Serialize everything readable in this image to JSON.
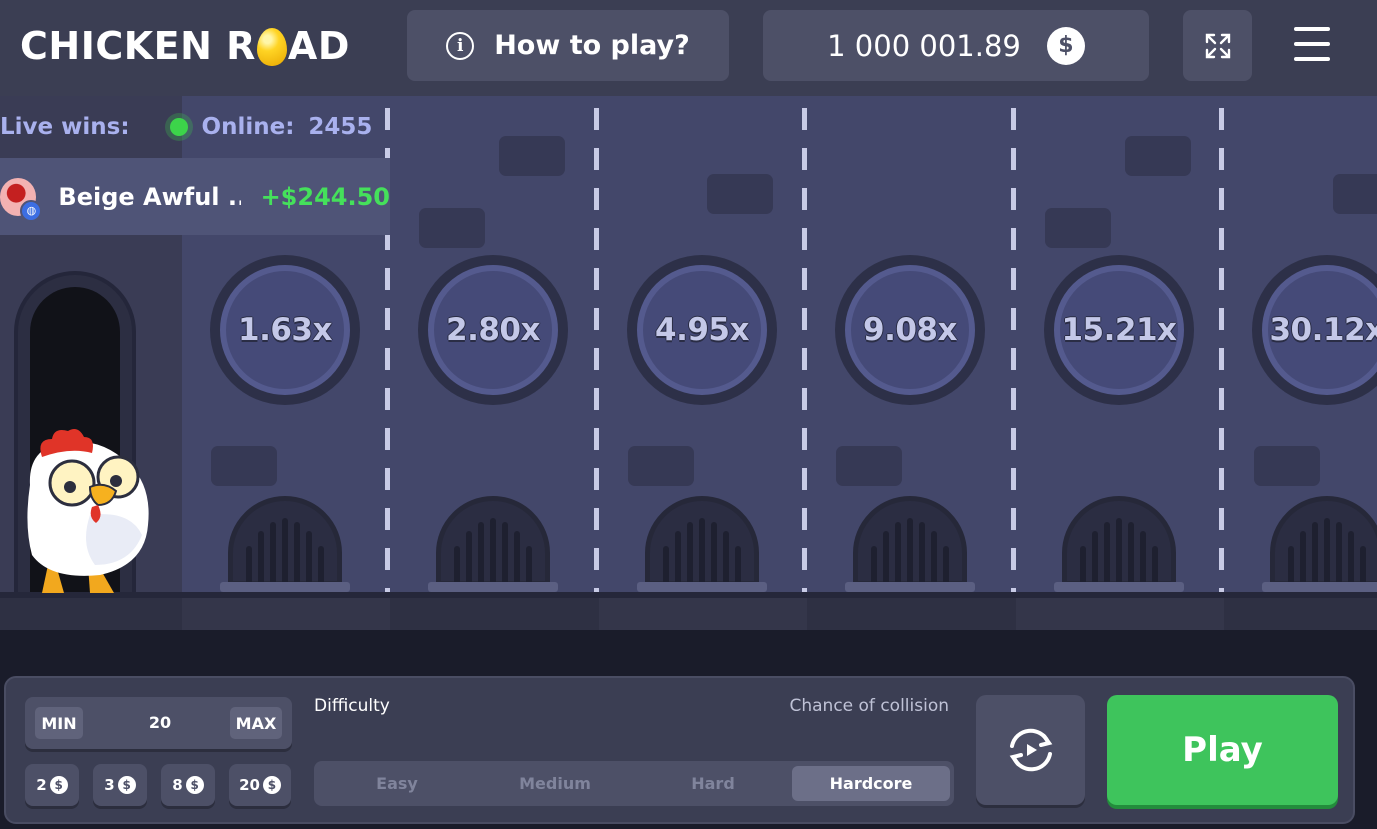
{
  "header": {
    "logo_left": "CHICKEN R",
    "logo_right": "AD",
    "how_to_play_label": "How to play?",
    "balance": "1 000 001.89",
    "currency_symbol": "$"
  },
  "live": {
    "live_wins_label": "Live wins:",
    "online_label": "Online:",
    "online_count": "2455",
    "latest_win": {
      "name": "Beige Awful ...",
      "amount": "+$244.50"
    }
  },
  "lanes": {
    "multipliers": [
      "1.63x",
      "2.80x",
      "4.95x",
      "9.08x",
      "15.21x",
      "30.12x"
    ]
  },
  "controls": {
    "min_label": "MIN",
    "max_label": "MAX",
    "bet_value": "20",
    "chips": [
      "2",
      "3",
      "8",
      "20"
    ],
    "chip_symbol": "$",
    "difficulty_label": "Difficulty",
    "chance_label": "Chance of collision",
    "difficulties": [
      "Easy",
      "Medium",
      "Hard",
      "Hardcore"
    ],
    "selected_difficulty": "Hardcore",
    "play_label": "Play"
  },
  "colors": {
    "header_bg": "#3b3e53",
    "game_bg": "#43476a",
    "accent_green": "#3ec45c",
    "win_green": "#45e05b",
    "online_dot": "#3cd44a"
  }
}
